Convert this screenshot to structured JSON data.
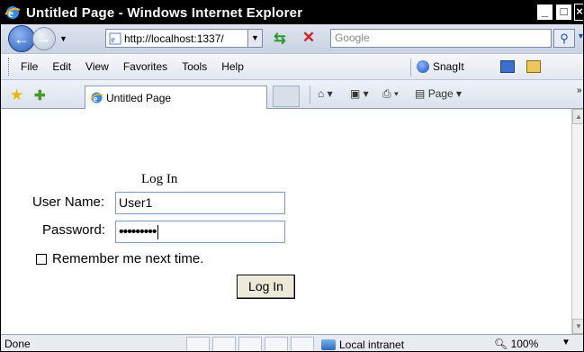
{
  "window": {
    "title": "Untitled Page - Windows Internet Explorer"
  },
  "address_bar": {
    "url": "http://localhost:1337/",
    "search_placeholder": "Google"
  },
  "menu": {
    "items": [
      "File",
      "Edit",
      "View",
      "Favorites",
      "Tools",
      "Help"
    ],
    "snagit_label": "SnagIt"
  },
  "tabs": {
    "active_label": "Untitled Page"
  },
  "command_bar": {
    "page_label": "Page"
  },
  "login": {
    "title": "Log In",
    "username_label": "User Name:",
    "username_value": "User1",
    "password_label": "Password:",
    "password_value": "•••••••••",
    "remember_label": "Remember me next time.",
    "button_label": "Log In"
  },
  "status": {
    "text": "Done",
    "zone": "Local intranet",
    "zoom": "100%"
  }
}
